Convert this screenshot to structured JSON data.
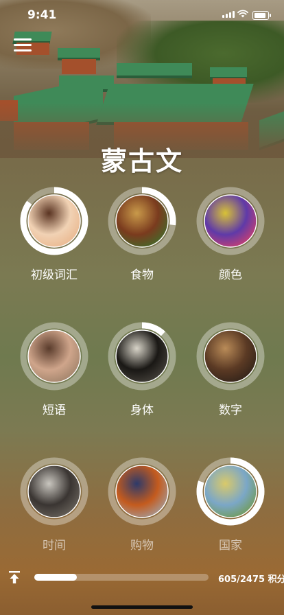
{
  "status_bar": {
    "time": "9:41"
  },
  "header": {
    "title": "蒙古文"
  },
  "categories": [
    {
      "label": "初级词汇",
      "progress": 0.85,
      "icon": "child-face-photo",
      "dim": false
    },
    {
      "label": "食物",
      "progress": 0.27,
      "icon": "burger-photo",
      "dim": false
    },
    {
      "label": "颜色",
      "progress": 0.0,
      "icon": "color-powder-photo",
      "dim": false
    },
    {
      "label": "短语",
      "progress": 0.0,
      "icon": "people-talking-photo",
      "dim": false
    },
    {
      "label": "身体",
      "progress": 0.12,
      "icon": "skeleton-photo",
      "dim": false
    },
    {
      "label": "数字",
      "progress": 0.0,
      "icon": "number-blocks-photo",
      "dim": false
    },
    {
      "label": "时间",
      "progress": 0.0,
      "icon": "alarm-clock-photo",
      "dim": true
    },
    {
      "label": "购物",
      "progress": 0.0,
      "icon": "shopping-cart-photo",
      "dim": true
    },
    {
      "label": "国家",
      "progress": 0.8,
      "icon": "world-map-photo",
      "dim": true
    }
  ],
  "footer": {
    "score": "605/2475 积分",
    "progress": 0.245,
    "icon": "upload-icon"
  }
}
